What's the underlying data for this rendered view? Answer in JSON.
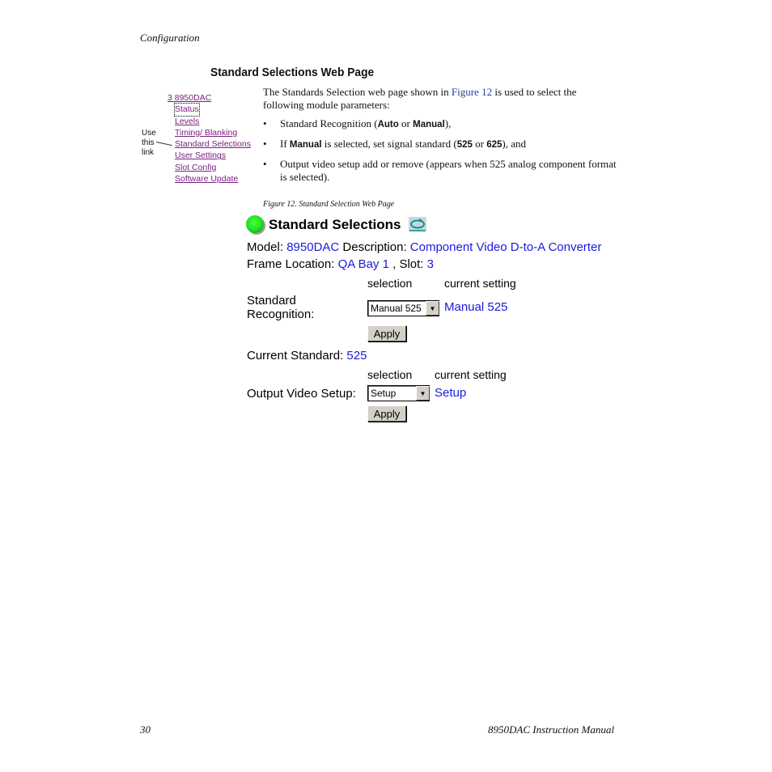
{
  "header": {
    "section": "Configuration"
  },
  "section_title": "Standard Selections Web Page",
  "nav": {
    "root": "3 8950DAC",
    "items": [
      "Status",
      "Levels",
      "Timing/ Blanking",
      "Standard Selections",
      "User Settings",
      "Slot Config",
      "Software Update"
    ]
  },
  "callout": {
    "line1": "Use",
    "line2": "this",
    "line3": "link"
  },
  "intro": {
    "pre": "The Standards Selection web page shown in ",
    "link": "Figure 12",
    "post": " is used to select the following module parameters:",
    "bullet1": {
      "pre": "Standard Recognition (",
      "b1": "Auto",
      "mid": " or ",
      "b2": "Manual",
      "post": "),"
    },
    "bullet2": {
      "pre": "If ",
      "b1": "Manual",
      "mid": " is selected, set signal standard (",
      "b2": "525",
      "mid2": " or ",
      "b3": "625",
      "post": "), and"
    },
    "bullet3": "Output video setup add or remove (appears when 525 analog component format is selected)."
  },
  "figure_caption": "Figure 12.  Standard Selection Web Page",
  "web": {
    "title": "Standard Selections",
    "model_label": "Model: ",
    "model_value": "8950DAC",
    "description_label": " Description: ",
    "description_value": "Component Video D-to-A Converter",
    "frame_label": "Frame Location: ",
    "frame_value": "QA Bay 1",
    "slot_label": " , Slot: ",
    "slot_value": "3",
    "selection_header": "selection",
    "current_setting_header": "current setting",
    "std_recognition_label_1": "Standard",
    "std_recognition_label_2": "Recognition:",
    "std_recognition_select": "Manual 525",
    "std_recognition_current": "Manual 525",
    "apply_label": "Apply",
    "current_standard_label": "Current Standard: ",
    "current_standard_value": "525",
    "output_video_label": "Output Video Setup:",
    "output_video_select": "Setup",
    "output_video_current": "Setup",
    "colors": {
      "value_blue": "#1a1add",
      "nav_purple": "#7a1f80",
      "status_green": "#22dd22"
    }
  },
  "footer": {
    "page_number": "30",
    "manual_title": "8950DAC Instruction Manual"
  }
}
